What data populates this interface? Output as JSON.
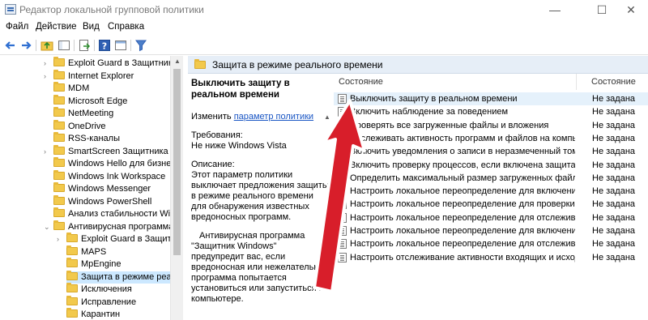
{
  "window": {
    "title": "Редактор локальной групповой политики",
    "minimize": "—",
    "maximize": "☐",
    "close": "✕"
  },
  "menu": [
    "Файл",
    "Действие",
    "Вид",
    "Справка"
  ],
  "tree": [
    {
      "label": "Exploit Guard в Защитнике",
      "depth": 1,
      "expander": "›"
    },
    {
      "label": "Internet Explorer",
      "depth": 1,
      "expander": "›"
    },
    {
      "label": "MDM",
      "depth": 1,
      "expander": ""
    },
    {
      "label": "Microsoft Edge",
      "depth": 1,
      "expander": ""
    },
    {
      "label": "NetMeeting",
      "depth": 1,
      "expander": ""
    },
    {
      "label": "OneDrive",
      "depth": 1,
      "expander": ""
    },
    {
      "label": "RSS-каналы",
      "depth": 1,
      "expander": ""
    },
    {
      "label": "SmartScreen Защитника Wi",
      "depth": 1,
      "expander": "›"
    },
    {
      "label": "Windows Hello для бизнеса",
      "depth": 1,
      "expander": ""
    },
    {
      "label": "Windows Ink Workspace",
      "depth": 1,
      "expander": ""
    },
    {
      "label": "Windows Messenger",
      "depth": 1,
      "expander": ""
    },
    {
      "label": "Windows PowerShell",
      "depth": 1,
      "expander": ""
    },
    {
      "label": "Анализ стабильности Winc",
      "depth": 1,
      "expander": ""
    },
    {
      "label": "Антивирусная программа",
      "depth": 1,
      "expander": "⌄"
    },
    {
      "label": "Exploit Guard в Защитн",
      "depth": 2,
      "expander": "›"
    },
    {
      "label": "MAPS",
      "depth": 2,
      "expander": ""
    },
    {
      "label": "MpEngine",
      "depth": 2,
      "expander": ""
    },
    {
      "label": "Защита в режиме реалы",
      "depth": 2,
      "expander": "",
      "selected": true
    },
    {
      "label": "Исключения",
      "depth": 2,
      "expander": ""
    },
    {
      "label": "Исправление",
      "depth": 2,
      "expander": ""
    },
    {
      "label": "Карантин",
      "depth": 2,
      "expander": ""
    }
  ],
  "right_header": "Защита в режиме реального времени",
  "description": {
    "title": "Выключить защиту в реальном времени",
    "edit_prefix": "Изменить",
    "edit_link": "параметр политики",
    "requirements_label": "Требования:",
    "requirements_value": "Не ниже Windows Vista",
    "description_label": "Описание:",
    "description_text": "Этот параметр политики выключает предложения защиты в режиме реального времени для обнаружения известных вредоносных программ.",
    "more_text": "Антивирусная программа \"Защитник Windows\" предупредит вас, если вредоносная или нежелательная программа попытается установиться или запуститься на компьютере."
  },
  "columns": {
    "name": "Состояние",
    "state": "Состояние"
  },
  "policies": [
    {
      "name": "Выключить защиту в реальном времени",
      "state": "Не задана",
      "selected": true
    },
    {
      "name": "Включить наблюдение за поведением",
      "state": "Не задана"
    },
    {
      "name": "Проверять все загруженные файлы и вложения",
      "state": "Не задана"
    },
    {
      "name": "Отслеживать активность программ и файлов на компью...",
      "state": "Не задана"
    },
    {
      "name": "Включить уведомления о записи в неразмеченный том",
      "state": "Не задана"
    },
    {
      "name": "Включить проверку процессов, если включена защита в ...",
      "state": "Не задана"
    },
    {
      "name": "Определить максимальный размер загруженных файлов...",
      "state": "Не задана"
    },
    {
      "name": "Настроить локальное переопределение для включения к...",
      "state": "Не задана"
    },
    {
      "name": "Настроить локальное переопределение для проверки вс...",
      "state": "Не задана"
    },
    {
      "name": "Настроить локальное переопределение для отслеживан...",
      "state": "Не задана"
    },
    {
      "name": "Настроить локальное переопределение для включения в...",
      "state": "Не задана"
    },
    {
      "name": "Настроить локальное переопределение для отслеживан...",
      "state": "Не задана"
    },
    {
      "name": "Настроить отслеживание активности входящих и исходя...",
      "state": "Не задана"
    }
  ],
  "colors": {
    "annotation_arrow": "#d81e2a",
    "selection": "#cce8ff",
    "header_bg": "#e6eef7",
    "link": "#1a56c4"
  }
}
